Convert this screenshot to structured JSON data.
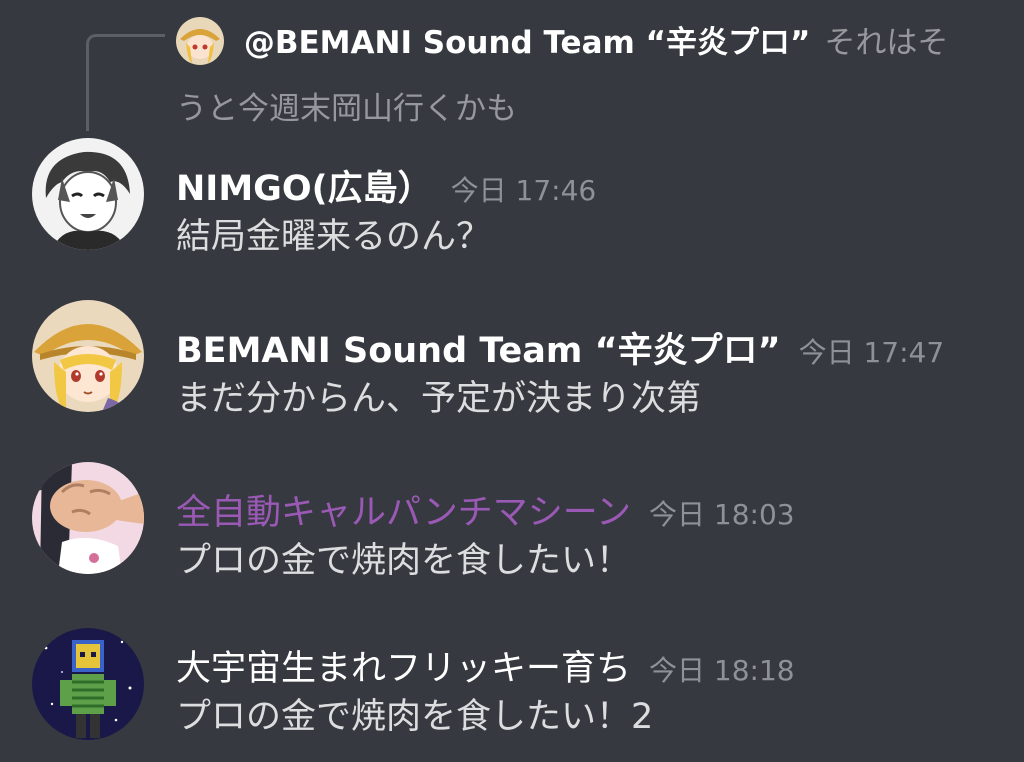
{
  "reply": {
    "author": "@BEMANI Sound Team “辛炎プロ”",
    "text_line1": "それはそ",
    "text_line2": "うと今週末岡山行くかも",
    "avatar_icon": "anime-girl-hat-avatar"
  },
  "messages": [
    {
      "author": "NIMGO(広島）",
      "timestamp": "今日 17:46",
      "text": "結局金曜来るのん？",
      "avatar_icon": "monochrome-anime-avatar"
    },
    {
      "author": "BEMANI Sound Team “辛炎プロ”",
      "timestamp": "今日 17:47",
      "text": "まだ分からん、予定が決まり次第",
      "avatar_icon": "anime-girl-hat-avatar"
    },
    {
      "author": "全自動キャルパンチマシーン",
      "timestamp": "今日 18:03",
      "text": "プロの金で焼肉を食したい！",
      "avatar_icon": "fist-punch-avatar",
      "name_color": "#9b59b6"
    },
    {
      "author": "大宇宙生まれフリッキー育ち",
      "timestamp": "今日 18:18",
      "text": "プロの金で焼肉を食したい！2",
      "avatar_icon": "space-robot-avatar"
    }
  ],
  "colors": {
    "background": "#36393f",
    "username": "#ffffff",
    "message_text": "#dcddde",
    "timestamp": "#8e9297",
    "role_purple": "#9b59b6"
  }
}
